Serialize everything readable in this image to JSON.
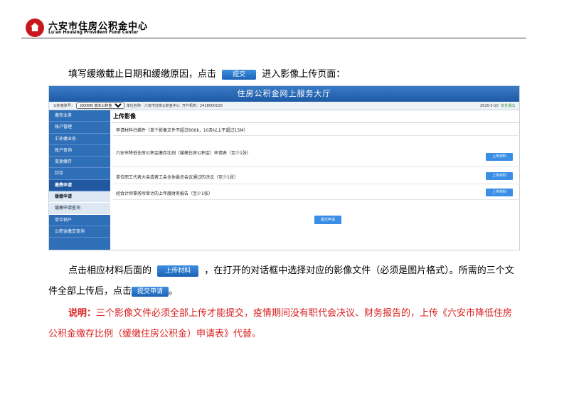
{
  "header": {
    "name_cn": "六安市住房公积金中心",
    "name_en": "Lu'an Housing Provident Fund Center"
  },
  "paragraph1": {
    "before": "填写缓缴截止日期和缓缴原因，点击",
    "button": "提交",
    "after": "进入影像上传页面："
  },
  "screenshot": {
    "title": "住房公积金网上服务大厅",
    "bar": {
      "account_label": "公积金账号：",
      "account_value": "1000000 基本公积金",
      "unit_label": "单位名称：",
      "unit_value": "六安市住房公积金中心",
      "user_label": "开户机构：",
      "user_value": "2418000100",
      "date": "2020-3-10",
      "logout": "安全退出"
    },
    "sidebar": [
      "缴存业务",
      "账户管理",
      "汇补缴业务",
      "账户查询",
      "变更缴存",
      "封存",
      "缴费申请",
      "缓缴申请",
      "缓缴申请查询",
      "单位销户",
      "公积金缴交查询"
    ],
    "main_title": "上传影像",
    "notice": "申请材料扫描件（单个影像文件不超过600k，10及以上不超过15M）",
    "items": [
      {
        "text": "六安市降低住房公积金缴存比例（缓缴住房公积金）申请表（至少1张）",
        "btn": "上传材料"
      },
      {
        "text": "单位职工代表大会或者工会全体委员会议通过的决议（至少1张）",
        "btn": "上传材料"
      },
      {
        "text": "经会计师事务所审计的上年度财务报告（至少1张）",
        "btn": "上传材料"
      }
    ],
    "submit": "提交申请"
  },
  "paragraph2": {
    "before": "点击相应材料后面的",
    "button": "上传材料",
    "after": "，在打开的对话框中选择对应的影像文件（必须是图片格式）。所需的三个文",
    "line2_before": "件全部上传后，点击",
    "button2": "提交申请",
    "line2_after": "。"
  },
  "note": {
    "label": "说明：",
    "line1": "三个影像文件必须全部上传才能提交，疫情期间没有职代会决议、财务报告的，上传《六安市降低住房",
    "line2": "公积金缴存比例（缓缴住房公积金）申请表》代替。"
  }
}
